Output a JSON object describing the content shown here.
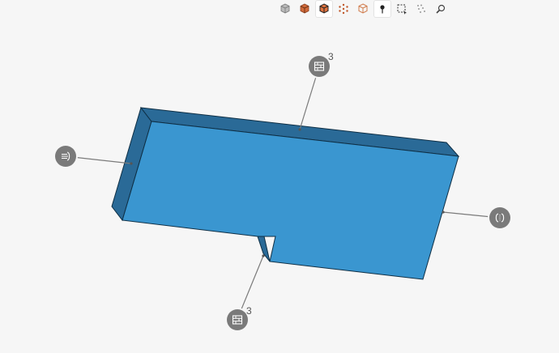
{
  "toolbar": {
    "buttons": [
      {
        "icon": "view-cube-icon",
        "active": false
      },
      {
        "icon": "solid-view-icon",
        "active": false
      },
      {
        "icon": "shaded-edges-view-icon",
        "active": true
      },
      {
        "icon": "points-view-icon",
        "active": false
      },
      {
        "icon": "wireframe-view-icon",
        "active": false
      },
      {
        "icon": "pin-icon",
        "active": true
      },
      {
        "icon": "box-select-icon",
        "active": false
      },
      {
        "icon": "scatter-select-icon",
        "active": false
      },
      {
        "icon": "zoom-icon",
        "active": false
      }
    ]
  },
  "viewport": {
    "model_color": "#3a96d0",
    "model_side_color": "#2a6a97",
    "markers": [
      {
        "icon": "wall-boundary-icon",
        "count": "3"
      },
      {
        "icon": "inlet-flow-icon",
        "count": ""
      },
      {
        "icon": "outlet-icon",
        "count": ""
      },
      {
        "icon": "wall-boundary-icon",
        "count": "3"
      }
    ]
  }
}
